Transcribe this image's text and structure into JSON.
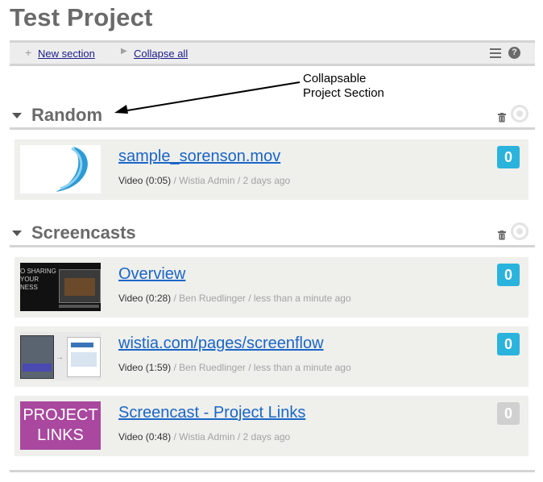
{
  "page": {
    "title": "Test Project"
  },
  "toolbar": {
    "new_section_label": "New section",
    "collapse_all_label": "Collapse all",
    "plus_icon": "plus-icon",
    "arrow_icon": "right-arrow-icon",
    "menu_icon": "list-menu-icon",
    "help_icon": "help-icon",
    "help_glyph": "?"
  },
  "annotation": {
    "line1": "Collapsable",
    "line2": "Project Section"
  },
  "colors": {
    "link": "#1a66c7",
    "badge_active": "#2ab3dc",
    "badge_inactive": "#d0d0d0",
    "section_title": "#6a6a6a"
  },
  "sections": [
    {
      "title": "Random",
      "items": [
        {
          "title": "sample_sorenson.mov",
          "type_duration": "Video (0:05)",
          "owner_time": " / Wistia Admin / 2 days ago",
          "count": "0",
          "thumbnail": "swoosh"
        }
      ]
    },
    {
      "title": "Screencasts",
      "items": [
        {
          "title": "Overview",
          "type_duration": "Video (0:28)",
          "owner_time": " / Ben Ruedlinger / less than a minute ago",
          "count": "0",
          "thumbnail": "video",
          "thumb_text": [
            "O SHARING",
            "YOUR",
            "NESS"
          ]
        },
        {
          "title": "wistia.com/pages/screenflow",
          "type_duration": "Video (1:59)",
          "owner_time": " / Ben Ruedlinger / less than a minute ago",
          "count": "0",
          "thumbnail": "screens"
        },
        {
          "title": "Screencast - Project Links",
          "type_duration": "Video (0:48)",
          "owner_time": " / Wistia Admin / 2 days ago",
          "count": "0",
          "thumbnail": "text",
          "thumb_text": [
            "PROJECT",
            "LINKS"
          ]
        }
      ]
    }
  ]
}
